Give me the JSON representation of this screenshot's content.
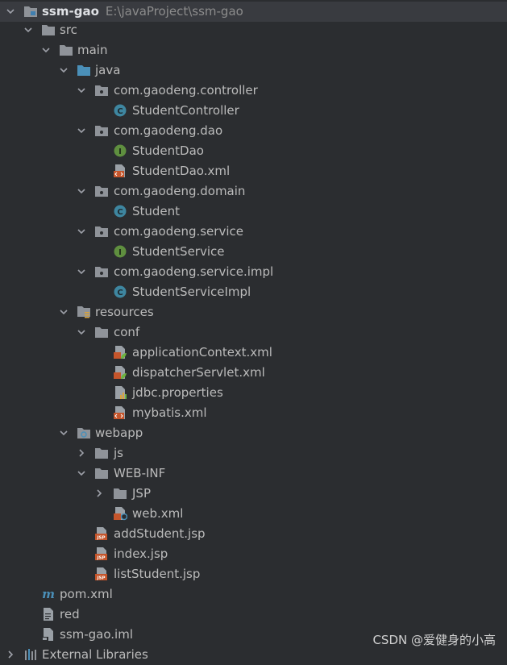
{
  "project": {
    "name": "ssm-gao",
    "path": "E:\\javaProject\\ssm-gao"
  },
  "tree": {
    "src": "src",
    "main": "main",
    "java": "java",
    "pkg_controller": "com.gaodeng.controller",
    "student_controller": "StudentController",
    "pkg_dao": "com.gaodeng.dao",
    "student_dao": "StudentDao",
    "student_dao_xml": "StudentDao.xml",
    "pkg_domain": "com.gaodeng.domain",
    "student": "Student",
    "pkg_service": "com.gaodeng.service",
    "student_service": "StudentService",
    "pkg_service_impl": "com.gaodeng.service.impl",
    "student_service_impl": "StudentServiceImpl",
    "resources": "resources",
    "conf": "conf",
    "application_context": "applicationContext.xml",
    "dispatcher_servlet": "dispatcherServlet.xml",
    "jdbc_properties": "jdbc.properties",
    "mybatis_xml": "mybatis.xml",
    "webapp": "webapp",
    "js": "js",
    "web_inf": "WEB-INF",
    "jsp_folder": "JSP",
    "web_xml": "web.xml",
    "add_student_jsp": "addStudent.jsp",
    "index_jsp": "index.jsp",
    "list_student_jsp": "listStudent.jsp",
    "pom_xml": "pom.xml",
    "red": "red",
    "ssm_gao_iml": "ssm-gao.iml",
    "external_libraries": "External Libraries"
  },
  "watermark": "CSDN @爱健身的小高",
  "icons": {
    "folder": "folder-icon",
    "source_folder": "source-folder-icon",
    "package": "package-icon",
    "class": "class-icon",
    "interface": "interface-icon",
    "xml": "xml-file-icon",
    "spring_xml": "spring-xml-icon",
    "properties": "properties-file-icon",
    "jsp": "jsp-file-icon",
    "maven": "maven-icon",
    "text": "text-file-icon"
  },
  "colors": {
    "background": "#2b2d30",
    "selected_row": "#393b40",
    "text": "#bbbbbb",
    "muted": "#8c8c8c",
    "class_blue": "#3e86a0",
    "interface_green": "#5f8f3f",
    "xml_orange": "#c5552b",
    "folder_gray": "#8f9399",
    "source_blue": "#4a8fb8"
  }
}
